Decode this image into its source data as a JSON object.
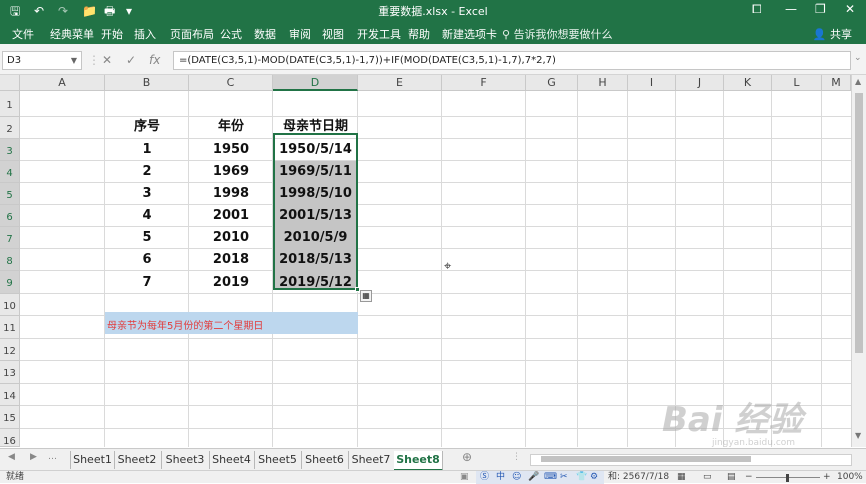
{
  "window": {
    "title": "重要数据.xlsx - Excel",
    "quick_access": [
      "🖫",
      "↶",
      "↷",
      "📁",
      "🖶",
      "▾"
    ],
    "controls": [
      "—",
      "❐",
      "✕",
      "⧠"
    ]
  },
  "ribbon": {
    "tabs": [
      "文件",
      "经典菜单",
      "开始",
      "插入",
      "页面布局",
      "公式",
      "数据",
      "审阅",
      "视图",
      "开发工具",
      "帮助",
      "新建选项卡"
    ],
    "tell_me": "告诉我你想要做什么",
    "share": "共享"
  },
  "formula_bar": {
    "name_box": "D3",
    "cancel_icon": "✕",
    "enter_icon": "✓",
    "fx": "fx",
    "formula": "=(DATE(C3,5,1)-MOD(DATE(C3,5,1)-1,7))+IF(MOD(DATE(C3,5,1)-1,7),7*2,7)"
  },
  "grid": {
    "columns": [
      "A",
      "B",
      "C",
      "D",
      "E",
      "F",
      "G",
      "H",
      "I",
      "J",
      "K",
      "L",
      "M"
    ],
    "rows": [
      "1",
      "2",
      "3",
      "4",
      "5",
      "6",
      "7",
      "8",
      "9",
      "10",
      "11",
      "12",
      "13",
      "14",
      "15",
      "16"
    ],
    "selected_column": "D",
    "selected_rows": [
      "3",
      "4",
      "5",
      "6",
      "7",
      "8",
      "9"
    ]
  },
  "table": {
    "headers": [
      "序号",
      "年份",
      "母亲节日期"
    ],
    "rows": [
      [
        "1",
        "1950",
        "1950/5/14"
      ],
      [
        "2",
        "1969",
        "1969/5/11"
      ],
      [
        "3",
        "1998",
        "1998/5/10"
      ],
      [
        "4",
        "2001",
        "2001/5/13"
      ],
      [
        "5",
        "2010",
        "2010/5/9"
      ],
      [
        "6",
        "2018",
        "2018/5/13"
      ],
      [
        "7",
        "2019",
        "2019/5/12"
      ]
    ]
  },
  "note": "母亲节为每年5月份的第二个星期日",
  "sheets": [
    "Sheet1",
    "Sheet2",
    "Sheet3",
    "Sheet4",
    "Sheet5",
    "Sheet6",
    "Sheet7",
    "Sheet8"
  ],
  "active_sheet": "Sheet8",
  "add_sheet": "⊕",
  "status": {
    "mode": "就绪",
    "sum": "和: 2567/7/18",
    "zoom": "100%",
    "ime_icons": [
      "Ⓢ",
      "中",
      "☺",
      "🎤",
      "⌨",
      "✂",
      "👕",
      "⚙"
    ]
  },
  "watermark": {
    "text": "Bai 经验",
    "url": "jingyan.baidu.com"
  },
  "colors": {
    "excel_green": "#217346",
    "selection_fill": "#c5c5c5",
    "note_fill": "#bdd7ee",
    "note_text": "#e23b3b"
  }
}
